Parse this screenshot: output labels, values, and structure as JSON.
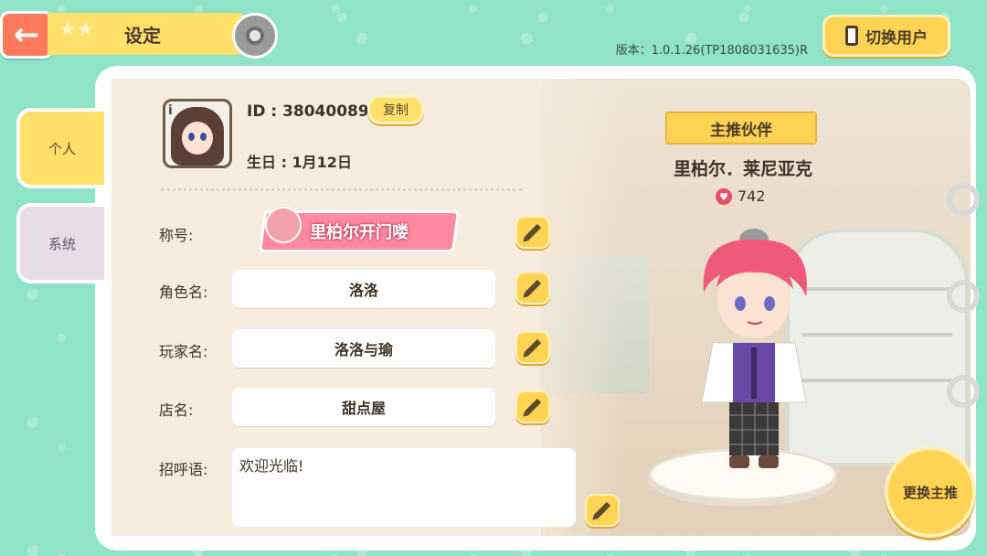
{
  "header": {
    "title": "设定",
    "version": "版本：1.0.1.26(TP1808031635)R",
    "switch_user_label": "切换用户"
  },
  "tabs": [
    {
      "label": "个人",
      "active": true
    },
    {
      "label": "系统",
      "active": false
    }
  ],
  "profile": {
    "id_text": "ID : 38040089",
    "copy_label": "复制",
    "birthday_text": "生日 : 1月12日",
    "title_label": "称号:",
    "title_badge": "里柏尔开门喽",
    "role_name_label": "角色名:",
    "role_name": "洛洛",
    "player_name_label": "玩家名:",
    "player_name": "洛洛与瑜",
    "shop_name_label": "店名:",
    "shop_name": "甜点屋",
    "greeting_label": "招呼语:",
    "greeting": "欢迎光临!"
  },
  "partner": {
    "ribbon": "主推伙伴",
    "name": "里柏尔．莱尼亚克",
    "affection": "742",
    "change_label": "更换主推"
  },
  "colors": {
    "background": "#8fe3c8",
    "accent_yellow": "#ffd454",
    "back_button": "#ff7a5c",
    "badge_pink": "#ff8aa0",
    "heart": "#e8506a"
  },
  "icons": [
    "back-arrow-icon",
    "gear-icon",
    "phone-icon",
    "pencil-icon",
    "heart-icon",
    "info-icon"
  ]
}
